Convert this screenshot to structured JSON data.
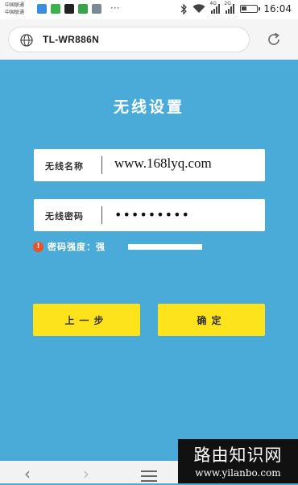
{
  "status_bar": {
    "carrier_line1": "中国联通",
    "carrier_line2": "中国联通",
    "more_indicator": "···",
    "signal1_label": "4G",
    "signal2_label": "2G",
    "battery_level": 0.4,
    "time": "16:04",
    "notification_icon_colors": [
      "#3b8de0",
      "#3cb34a",
      "#222222",
      "#3aa34a",
      "#7a8899"
    ]
  },
  "browser": {
    "url": "TL-WR886N",
    "icons": {
      "globe": "globe-icon",
      "reload": "reload-icon"
    }
  },
  "page": {
    "title": "无线设置",
    "ssid_label": "无线名称",
    "ssid_value": "www.168lyq.com",
    "password_label": "无线密码",
    "password_value": "•••••••••",
    "strength_text": "密码强度：强",
    "strength_level": 1.0,
    "warning_icon": "!",
    "prev_button": "上一步",
    "ok_button": "确定",
    "colors": {
      "background": "#4aabd9",
      "button": "#fde31c",
      "warning": "#e8532b"
    }
  },
  "nav": {
    "back": "‹",
    "forward": "›",
    "menu_icon": "menu-icon"
  },
  "watermark": {
    "title": "路由知识网",
    "url": "www.yilanbo.com"
  }
}
